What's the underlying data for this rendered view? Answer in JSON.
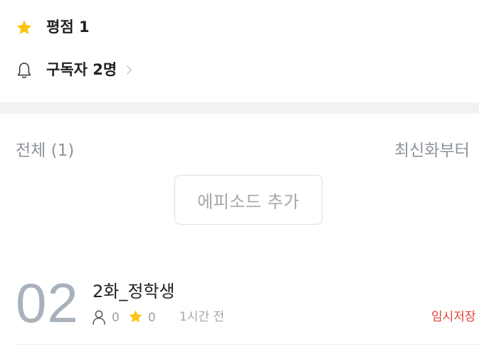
{
  "stats": {
    "rating_label": "평점 1",
    "subscribers_label": "구독자 2명"
  },
  "episodes": {
    "count_label": "전체 (1)",
    "sort_label": "최신화부터",
    "add_button_label": "에피소드 추가",
    "items": [
      {
        "number": "02",
        "title": "2화_정학생",
        "views": "0",
        "rating": "0",
        "time": "1시간 전",
        "status": "임시저장"
      }
    ]
  },
  "colors": {
    "star": "#f9c413",
    "draft": "#e0403a",
    "muted": "#8e949b"
  }
}
